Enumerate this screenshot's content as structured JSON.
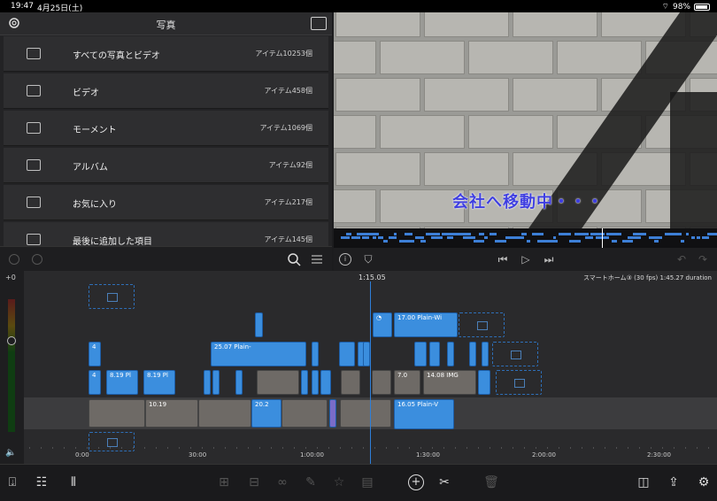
{
  "status_bar": {
    "time": "19:47",
    "date": "4月25日(土)",
    "battery": "98%"
  },
  "library": {
    "title": "写真",
    "items": [
      {
        "label": "すべての写真とビデオ",
        "count": "アイテム10253個",
        "icon": "folder-icon"
      },
      {
        "label": "ビデオ",
        "count": "アイテム458個",
        "icon": "video-camera-icon"
      },
      {
        "label": "モーメント",
        "count": "アイテム1069個",
        "icon": "moment-icon"
      },
      {
        "label": "アルバム",
        "count": "アイテム92個",
        "icon": "album-icon"
      },
      {
        "label": "お気に入り",
        "count": "アイテム217個",
        "icon": "heart-icon"
      },
      {
        "label": "最後に追加した項目",
        "count": "アイテム145個",
        "icon": "folder-icon"
      }
    ]
  },
  "preview": {
    "subtitle": "会社へ移動中・・・"
  },
  "timeline": {
    "playhead_time": "1:15.05",
    "project_info": "スマートホーム③ (30 fps)  1:45.27 duration",
    "volume_label": "+0",
    "ruler": [
      "0:00",
      "30:00",
      "1:00:00",
      "1:30:00",
      "2:00:00",
      "2:30:00"
    ],
    "clips": {
      "title_a": "17.00  Plain-Wi",
      "title_b": "25.07  Plain-",
      "c1": "8.19  Pl",
      "c2": "8.19  Pl",
      "c3": "10.19",
      "c4": "20.2",
      "c5": "16.05  Plain-V",
      "c6": "14.08  IMG",
      "c7": "7.0",
      "n4a": "4",
      "n4b": "4"
    }
  },
  "colors": {
    "accent": "#3b8ede",
    "subtitle": "#3f3fe0"
  }
}
